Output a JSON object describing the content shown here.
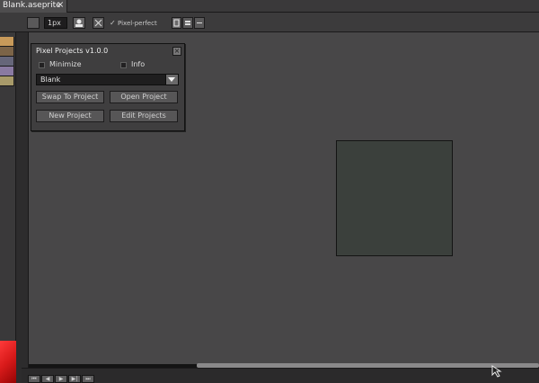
{
  "tab": {
    "title": "Blank.aseprite",
    "close": "×"
  },
  "toolbar": {
    "brush_size": "1px",
    "pixel_perfect_check": "✓",
    "pixel_perfect_label": "Pixel-perfect"
  },
  "palette": {
    "swatches": [
      "#c89a5a",
      "#7c6448",
      "#66667a",
      "#8a7aa2",
      "#a89a6a"
    ]
  },
  "dialog": {
    "title": "Pixel Projects v1.0.0",
    "close_label": "×",
    "minimize_label": "Minimize",
    "info_label": "Info",
    "dropdown_value": "Blank",
    "buttons": {
      "swap": "Swap To Project",
      "open": "Open Project",
      "new": "New Project",
      "edit": "Edit Projects"
    }
  },
  "timeline": {
    "buttons": [
      "⏮",
      "◀",
      "▶",
      "▶|",
      "⏭"
    ]
  }
}
